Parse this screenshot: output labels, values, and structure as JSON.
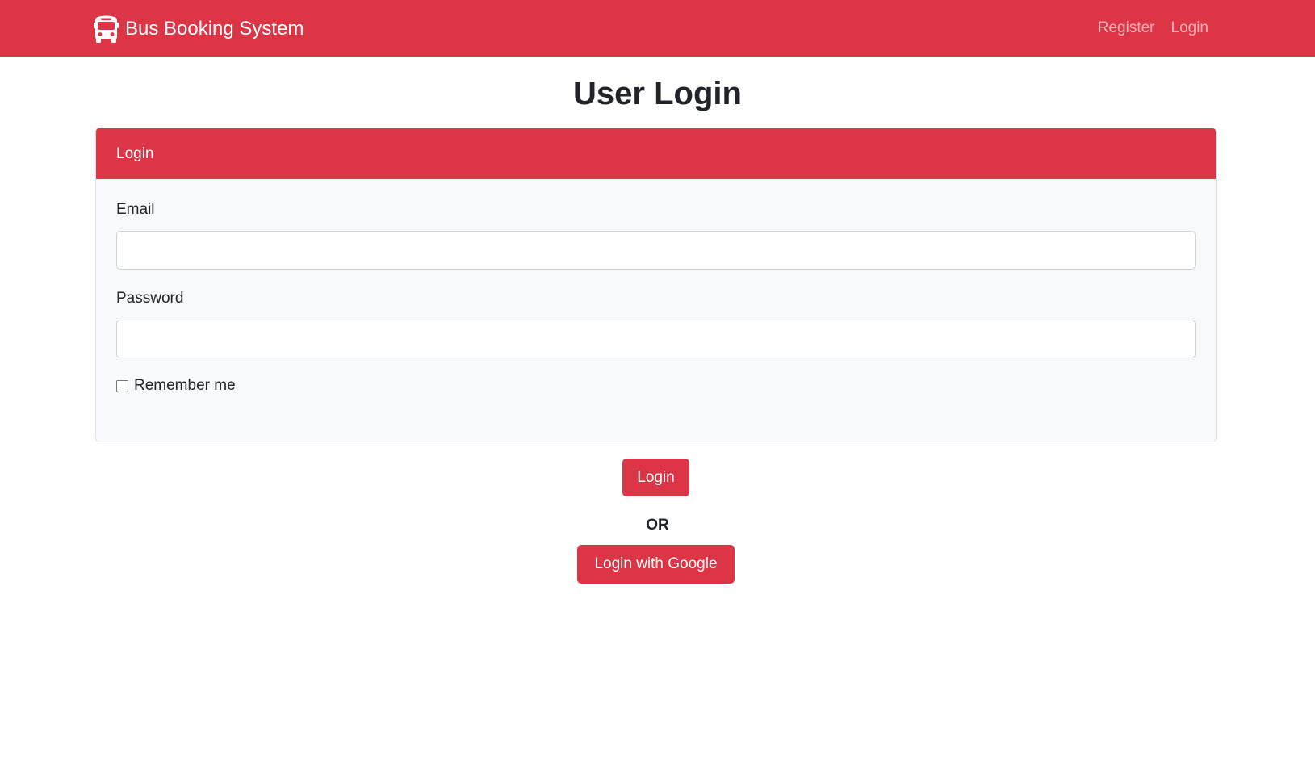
{
  "navbar": {
    "brand_icon": "bus-icon",
    "brand_text": "Bus Booking System",
    "links": [
      "Register",
      "Login"
    ],
    "color": "#dc3545"
  },
  "page": {
    "title": "User Login"
  },
  "card": {
    "header": "Login",
    "email_label": "Email",
    "email_value": "",
    "password_label": "Password",
    "password_value": "",
    "remember_label": "Remember me",
    "remember_checked": false
  },
  "actions": {
    "login_label": "Login",
    "or_label": "OR",
    "google_label": "Login with Google"
  }
}
